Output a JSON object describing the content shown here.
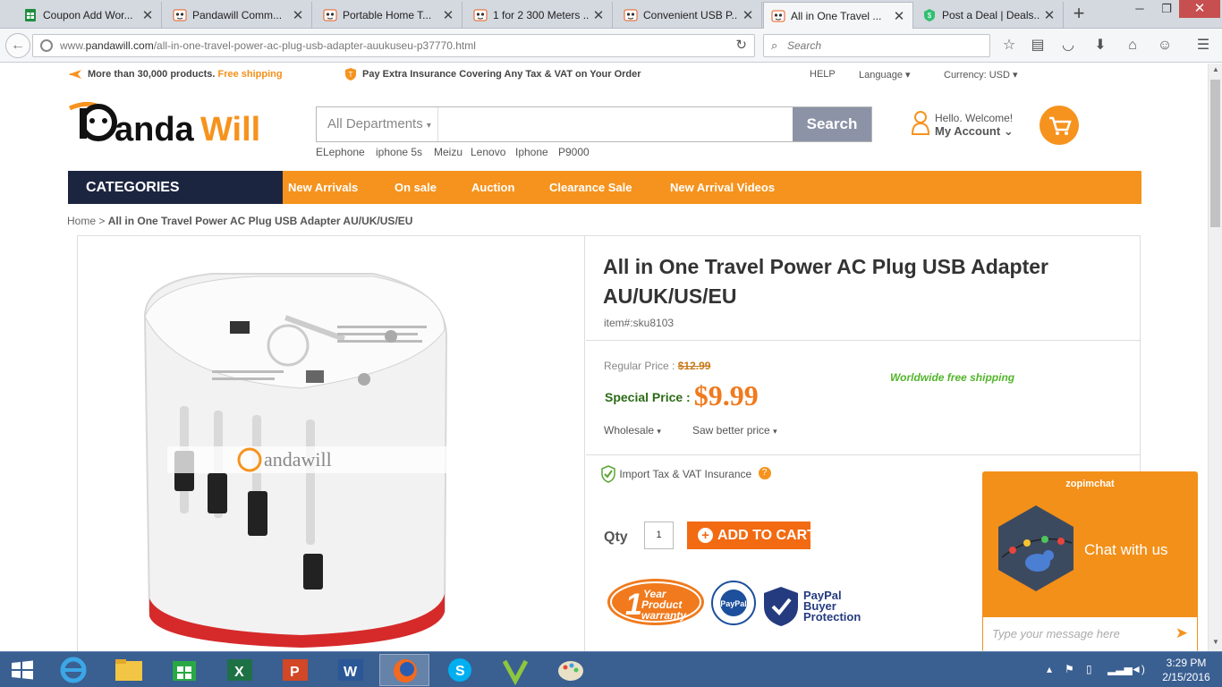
{
  "browser": {
    "tabs": [
      {
        "label": "Coupon Add Wor...",
        "icon": "sheets-icon",
        "color": "#1e8e3e"
      },
      {
        "label": "Pandawill Comm...",
        "icon": "panda-icon",
        "color": "#e85a1a"
      },
      {
        "label": "Portable Home T...",
        "icon": "panda-icon",
        "color": "#e85a1a"
      },
      {
        "label": "1 for 2 300 Meters ...",
        "icon": "panda-icon",
        "color": "#e85a1a"
      },
      {
        "label": "Convenient USB P...",
        "icon": "panda-icon",
        "color": "#e85a1a"
      },
      {
        "label": "All in One Travel ...",
        "icon": "panda-icon",
        "color": "#e85a1a",
        "active": true
      },
      {
        "label": "Post a Deal | Deals...",
        "icon": "dealspotr-icon",
        "color": "#2fbf71"
      }
    ],
    "url_prefix": "www.",
    "url_host": "pandawill.com",
    "url_path": "/all-in-one-travel-power-ac-plug-usb-adapter-auukuseu-p37770.html",
    "search_placeholder": "Search"
  },
  "site": {
    "promo1_a": "More than 30,000 products.",
    "promo1_b": "Free shipping",
    "promo2": "Pay Extra Insurance Covering Any Tax & VAT on Your Order",
    "help": "HELP",
    "language": "Language",
    "currency": "Currency: USD",
    "logo_a": "anda",
    "logo_b": "Will",
    "search_dept": "All Departments",
    "search_button": "Search",
    "hot_searches": [
      "ELephone",
      "iphone 5s",
      "Meizu",
      "Lenovo",
      "Iphone",
      "P9000"
    ],
    "account_hello": "Hello. Welcome!",
    "account_label": "My Account",
    "categories": "CATEGORIES",
    "nav": [
      "New Arrivals",
      "On sale",
      "Auction",
      "Clearance Sale",
      "New Arrival Videos"
    ],
    "brand_color": "#f6931e",
    "navy": "#1c2540"
  },
  "breadcrumb": {
    "home": "Home",
    "sep": ">",
    "current": "All in One Travel Power AC Plug USB Adapter AU/UK/US/EU"
  },
  "product": {
    "title": "All in One Travel Power AC Plug USB Adapter AU/UK/US/EU",
    "sku": "item#:sku8103",
    "regular_label": "Regular Price :",
    "regular_price": "$12.99",
    "special_label": "Special Price :",
    "special_price": "$9.99",
    "shipping": "Worldwide free shipping",
    "wholesale": "Wholesale",
    "better_price": "Saw better price",
    "tax_insurance": "Import Tax & VAT Insurance",
    "qty_label": "Qty",
    "qty_value": "1",
    "add_to_cart": "ADD TO CART",
    "watermark": "andawill",
    "warranty_big": "1",
    "warranty_a": "Year",
    "warranty_b": "Product",
    "warranty_c": "warranty",
    "seal_text": "PayPal",
    "paypal_a": "PayPal",
    "paypal_b": "Buyer",
    "paypal_c": "Protection"
  },
  "chat": {
    "brand": "zopimchat",
    "headline": "Chat with us",
    "placeholder": "Type your message here"
  },
  "taskbar": {
    "apps": [
      "ie-icon",
      "explorer-icon",
      "store-icon",
      "excel-icon",
      "powerpoint-icon",
      "word-icon",
      "firefox-icon",
      "skype-icon",
      "vine-icon",
      "paint-icon"
    ],
    "time": "3:29 PM",
    "date": "2/15/2016"
  }
}
